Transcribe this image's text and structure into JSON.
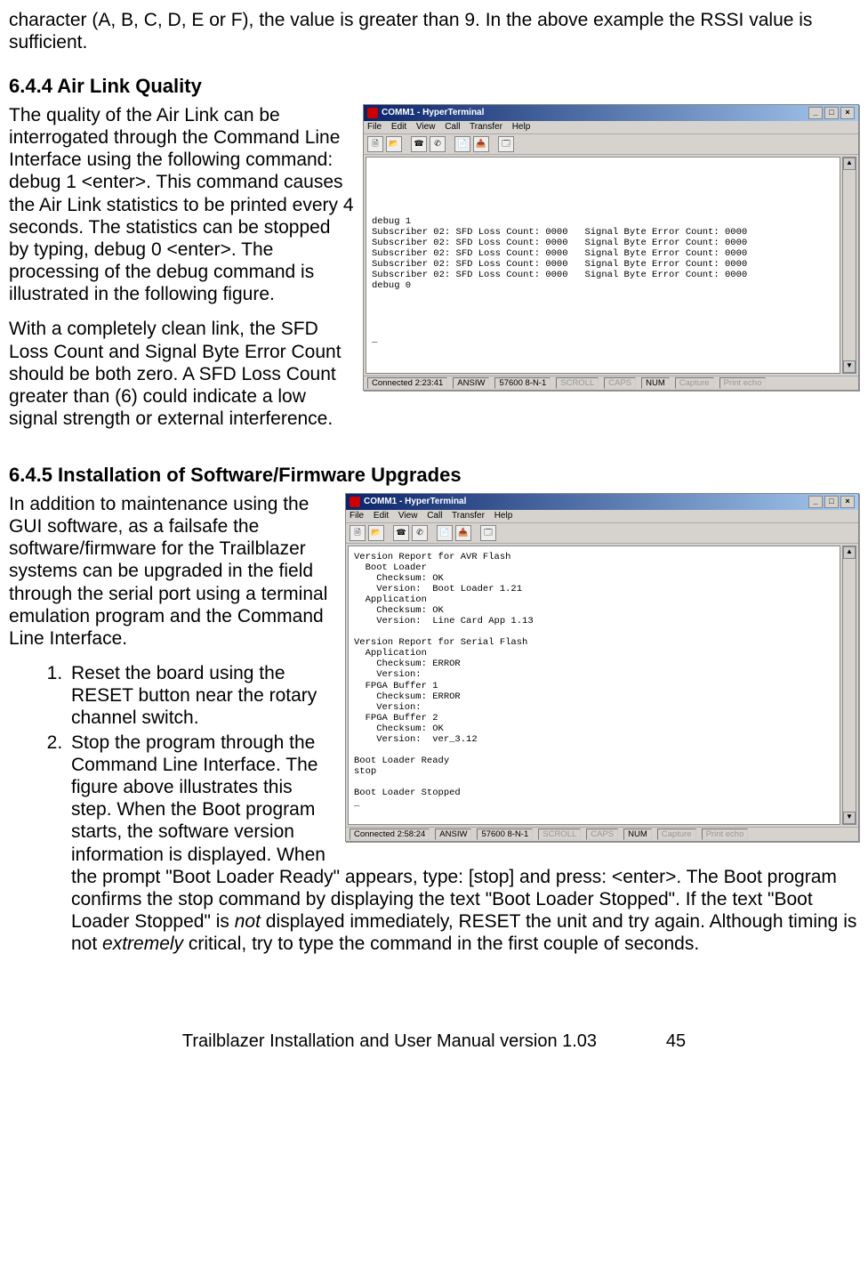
{
  "intro_partial": "character (A, B, C, D, E or F), the value is greater than 9.  In the above example the RSSI value is sufficient.",
  "sec644": {
    "heading": "6.4.4  Air Link Quality",
    "para1": "The quality of the Air Link can be interrogated through the Command Line Interface using the following command:  debug 1 <enter>.  This command causes the Air Link statistics to be printed every 4 seconds.  The statistics can be stopped by typing, debug 0 <enter>.   The processing of the debug command is illustrated in the following figure.",
    "para2": "With a completely clean link, the SFD Loss Count and Signal Byte Error Count should be both zero.  A SFD Loss Count greater than (6) could indicate a low signal strength or external interference."
  },
  "sec645": {
    "heading": "6.4.5  Installation of Software/Firmware Upgrades",
    "para1": "In addition to maintenance using the GUI software, as a failsafe the software/firmware for the Trailblazer systems can be upgraded in the field through the serial port using a terminal emulation program and the Command Line Interface.",
    "step1": "Reset the board using the RESET button near the rotary channel switch.",
    "step2_a": "Stop the program through the Command Line Interface.  The figure above illustrates this step.  When the Boot program starts, the software version information is displayed.  When the prompt \"Boot Loader Ready\" appears, type: [stop] and press: <enter>.  The Boot program confirms the stop command by displaying the text \"Boot Loader Stopped\". If the text \"Boot Loader Stopped\" is ",
    "step2_not": "not",
    "step2_b": " displayed immediately, RESET the unit and try again.  Although timing is not ",
    "step2_extremely": "extremely",
    "step2_c": " critical, try to type the command in the first couple of seconds."
  },
  "hyperterm": {
    "title": "COMM1 - HyperTerminal",
    "menu": [
      "File",
      "Edit",
      "View",
      "Call",
      "Transfer",
      "Help"
    ],
    "status1": {
      "conn": "Connected 2:23:41",
      "detect": "ANSIW",
      "port": "57600 8-N-1",
      "scroll": "SCROLL",
      "caps": "CAPS",
      "num": "NUM",
      "capture": "Capture",
      "echo": "Print echo"
    },
    "status2": {
      "conn": "Connected 2:58:24",
      "detect": "ANSIW",
      "port": "57600 8-N-1",
      "scroll": "SCROLL",
      "caps": "CAPS",
      "num": "NUM",
      "capture": "Capture",
      "echo": "Print echo"
    },
    "body1": "\n\n\n\n\ndebug 1\nSubscriber 02: SFD Loss Count: 0000   Signal Byte Error Count: 0000\nSubscriber 02: SFD Loss Count: 0000   Signal Byte Error Count: 0000\nSubscriber 02: SFD Loss Count: 0000   Signal Byte Error Count: 0000\nSubscriber 02: SFD Loss Count: 0000   Signal Byte Error Count: 0000\nSubscriber 02: SFD Loss Count: 0000   Signal Byte Error Count: 0000\ndebug 0\n\n\n\n\n_",
    "body2": "Version Report for AVR Flash\n  Boot Loader\n    Checksum: OK\n    Version:  Boot Loader 1.21\n  Application\n    Checksum: OK\n    Version:  Line Card App 1.13\n\nVersion Report for Serial Flash\n  Application\n    Checksum: ERROR\n    Version:\n  FPGA Buffer 1\n    Checksum: ERROR\n    Version:\n  FPGA Buffer 2\n    Checksum: OK\n    Version:  ver_3.12\n\nBoot Loader Ready\nstop\n\nBoot Loader Stopped\n_"
  },
  "footer": {
    "text": "Trailblazer Installation and User Manual version 1.03",
    "page": "45"
  }
}
